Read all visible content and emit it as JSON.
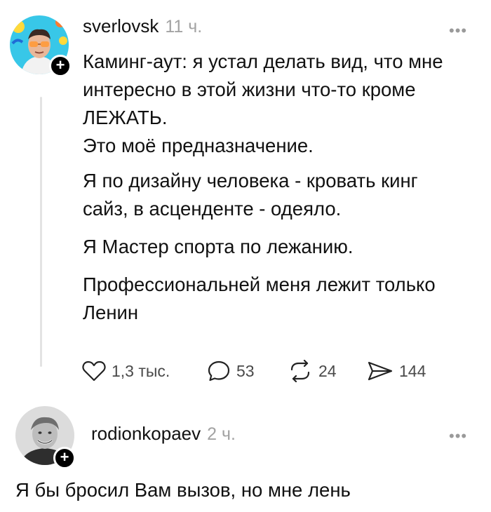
{
  "post": {
    "username": "sverlovsk",
    "time": "11 ч.",
    "more_label": "•••",
    "follow_label": "+",
    "text": {
      "line1": "Каминг-аут: я устал делать вид, что мне",
      "line2": "интересно в этой жизни что-то кроме",
      "line3": "ЛЕЖАТЬ.",
      "line4": "Это моё предназначение.",
      "para2_line1": "Я по дизайну человека - кровать кинг",
      "para2_line2": "сайз, в асценденте - одеяло.",
      "para3": "Я Мастер спорта по лежанию.",
      "para4_line1": "Профессиональней меня лежит только",
      "para4_line2": "Ленин"
    },
    "actions": {
      "likes": "1,3 тыс.",
      "comments": "53",
      "reposts": "24",
      "shares": "144"
    },
    "icons": [
      "heart-icon",
      "comment-icon",
      "repost-icon",
      "send-icon"
    ]
  },
  "reply": {
    "username": "rodionkopaev",
    "time": "2 ч.",
    "more_label": "•••",
    "follow_label": "+",
    "text": "Я бы бросил Вам вызов, но мне лень"
  },
  "colors": {
    "text": "#111111",
    "muted": "#a3a3a3",
    "thread_line": "#e3e3e3",
    "avatar1_bg": "#38c7e8"
  }
}
